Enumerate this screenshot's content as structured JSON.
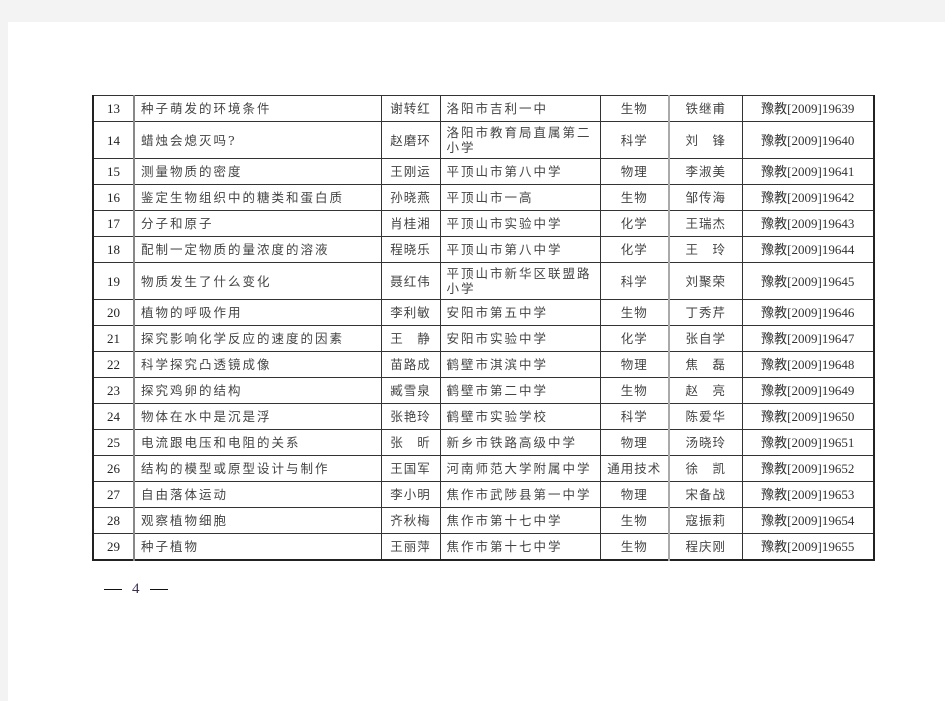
{
  "document": {
    "page_number": "4",
    "rows": [
      {
        "no": "13",
        "title": "种子萌发的环境条件",
        "teacher": "谢转红",
        "school": "洛阳市吉利一中",
        "subject": "生物",
        "mentor": "铁继甫",
        "cert": "豫教[2009]19639"
      },
      {
        "no": "14",
        "title": "蜡烛会熄灭吗?",
        "teacher": "赵磨环",
        "school": "洛阳市教育局直属第二小学",
        "subject": "科学",
        "mentor": "刘　锋",
        "cert": "豫教[2009]19640"
      },
      {
        "no": "15",
        "title": "测量物质的密度",
        "teacher": "王刚运",
        "school": "平顶山市第八中学",
        "subject": "物理",
        "mentor": "李淑美",
        "cert": "豫教[2009]19641"
      },
      {
        "no": "16",
        "title": "鉴定生物组织中的糖类和蛋白质",
        "teacher": "孙晓燕",
        "school": "平顶山市一高",
        "subject": "生物",
        "mentor": "邹传海",
        "cert": "豫教[2009]19642"
      },
      {
        "no": "17",
        "title": "分子和原子",
        "teacher": "肖桂湘",
        "school": "平顶山市实验中学",
        "subject": "化学",
        "mentor": "王瑞杰",
        "cert": "豫教[2009]19643"
      },
      {
        "no": "18",
        "title": "配制一定物质的量浓度的溶液",
        "teacher": "程晓乐",
        "school": "平顶山市第八中学",
        "subject": "化学",
        "mentor": "王　玲",
        "cert": "豫教[2009]19644"
      },
      {
        "no": "19",
        "title": "物质发生了什么变化",
        "teacher": "聂红伟",
        "school": "平顶山市新华区联盟路小学",
        "subject": "科学",
        "mentor": "刘聚荣",
        "cert": "豫教[2009]19645"
      },
      {
        "no": "20",
        "title": "植物的呼吸作用",
        "teacher": "李利敏",
        "school": "安阳市第五中学",
        "subject": "生物",
        "mentor": "丁秀芹",
        "cert": "豫教[2009]19646"
      },
      {
        "no": "21",
        "title": "探究影响化学反应的速度的因素",
        "teacher": "王　静",
        "school": "安阳市实验中学",
        "subject": "化学",
        "mentor": "张自学",
        "cert": "豫教[2009]19647"
      },
      {
        "no": "22",
        "title": "科学探究凸透镜成像",
        "teacher": "苗路成",
        "school": "鹤壁市淇滨中学",
        "subject": "物理",
        "mentor": "焦　磊",
        "cert": "豫教[2009]19648"
      },
      {
        "no": "23",
        "title": "探究鸡卵的结构",
        "teacher": "臧雪泉",
        "school": "鹤壁市第二中学",
        "subject": "生物",
        "mentor": "赵　亮",
        "cert": "豫教[2009]19649"
      },
      {
        "no": "24",
        "title": "物体在水中是沉是浮",
        "teacher": "张艳玲",
        "school": "鹤壁市实验学校",
        "subject": "科学",
        "mentor": "陈爱华",
        "cert": "豫教[2009]19650"
      },
      {
        "no": "25",
        "title": "电流跟电压和电阻的关系",
        "teacher": "张　昕",
        "school": "新乡市铁路高级中学",
        "subject": "物理",
        "mentor": "汤晓玲",
        "cert": "豫教[2009]19651"
      },
      {
        "no": "26",
        "title": "结构的模型或原型设计与制作",
        "teacher": "王国军",
        "school": "河南师范大学附属中学",
        "subject": "通用技术",
        "mentor": "徐　凯",
        "cert": "豫教[2009]19652"
      },
      {
        "no": "27",
        "title": "自由落体运动",
        "teacher": "李小明",
        "school": "焦作市武陟县第一中学",
        "subject": "物理",
        "mentor": "宋备战",
        "cert": "豫教[2009]19653"
      },
      {
        "no": "28",
        "title": "观察植物细胞",
        "teacher": "齐秋梅",
        "school": "焦作市第十七中学",
        "subject": "生物",
        "mentor": "寇振莉",
        "cert": "豫教[2009]19654"
      },
      {
        "no": "29",
        "title": "种子植物",
        "teacher": "王丽萍",
        "school": "焦作市第十七中学",
        "subject": "生物",
        "mentor": "程庆刚",
        "cert": "豫教[2009]19655"
      }
    ]
  }
}
